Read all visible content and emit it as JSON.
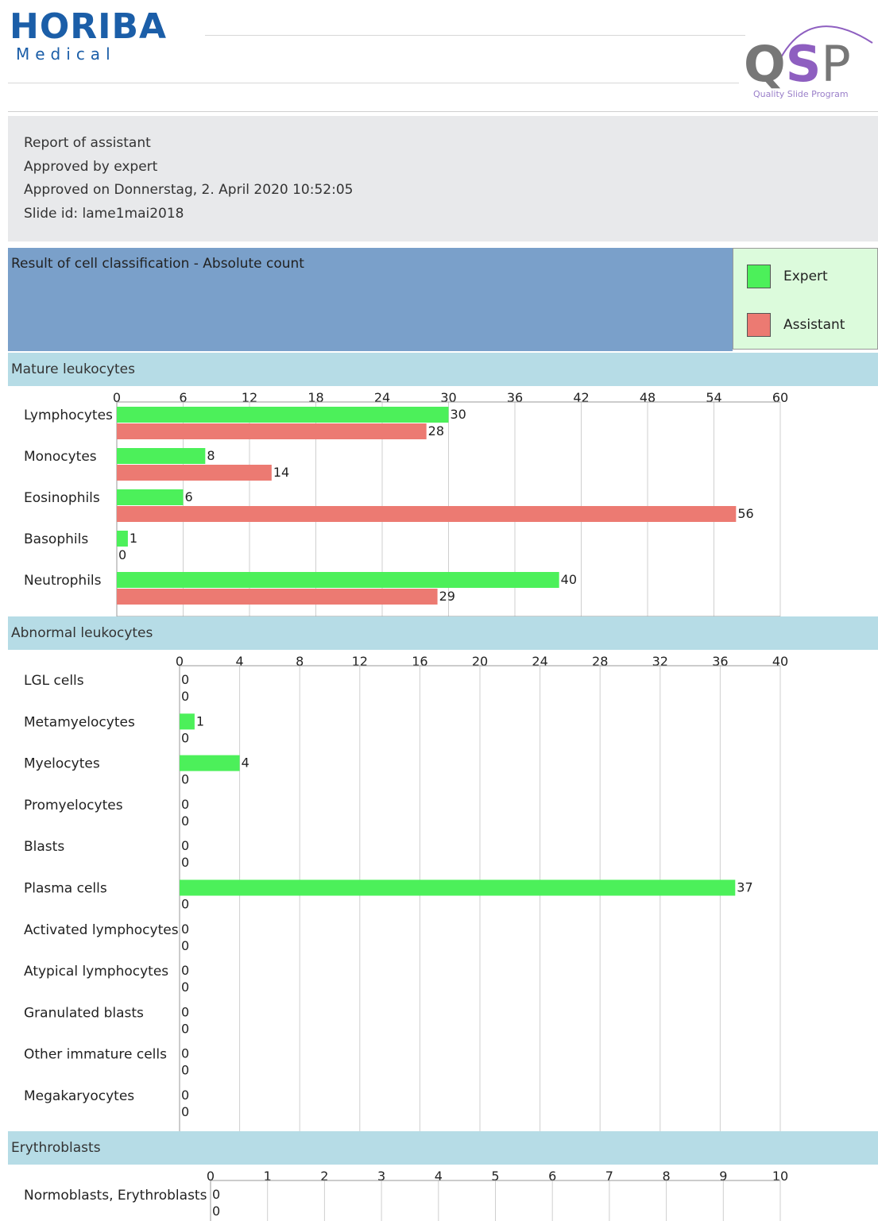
{
  "header": {
    "brand": "HORIBA",
    "brand_sub": "Medical",
    "qsp_q": "Q",
    "qsp_s": "S",
    "qsp_p": "P",
    "qsp_tagline": "Quality Slide Program"
  },
  "info": {
    "line1": "Report of assistant",
    "line2": "Approved by expert",
    "line3": "Approved on Donnerstag, 2. April 2020 10:52:05",
    "line4": "Slide id: lame1mai2018"
  },
  "result_title": "Result of cell classification - Absolute count",
  "legend": {
    "expert": "Expert",
    "assistant": "Assistant",
    "expert_color": "#4cf05a",
    "assistant_color": "#ec7a72"
  },
  "chart_data": [
    {
      "type": "bar",
      "section": "Mature leukocytes",
      "categories": [
        "Lymphocytes",
        "Monocytes",
        "Eosinophils",
        "Basophils",
        "Neutrophils"
      ],
      "series": [
        {
          "name": "Expert",
          "values": [
            30,
            8,
            6,
            1,
            40
          ]
        },
        {
          "name": "Assistant",
          "values": [
            28,
            14,
            56,
            0,
            29
          ]
        }
      ],
      "xticks": [
        0,
        6,
        12,
        18,
        24,
        30,
        36,
        42,
        48,
        54,
        60
      ],
      "xlim": [
        0,
        60
      ],
      "orientation": "horizontal"
    },
    {
      "type": "bar",
      "section": "Abnormal leukocytes",
      "categories": [
        "LGL cells",
        "Metamyelocytes",
        "Myelocytes",
        "Promyelocytes",
        "Blasts",
        "Plasma cells",
        "Activated lymphocytes",
        "Atypical lymphocytes",
        "Granulated blasts",
        "Other immature cells",
        "Megakaryocytes"
      ],
      "series": [
        {
          "name": "Expert",
          "values": [
            0,
            1,
            4,
            0,
            0,
            37,
            0,
            0,
            0,
            0,
            0
          ]
        },
        {
          "name": "Assistant",
          "values": [
            0,
            0,
            0,
            0,
            0,
            0,
            0,
            0,
            0,
            0,
            0
          ]
        }
      ],
      "xticks": [
        0,
        4,
        8,
        12,
        16,
        20,
        24,
        28,
        32,
        36,
        40
      ],
      "xlim": [
        0,
        40
      ],
      "orientation": "horizontal"
    },
    {
      "type": "bar",
      "section": "Erythroblasts",
      "categories": [
        "Normoblasts, Erythroblasts"
      ],
      "series": [
        {
          "name": "Expert",
          "values": [
            0
          ]
        },
        {
          "name": "Assistant",
          "values": [
            0
          ]
        }
      ],
      "xticks": [
        0,
        1,
        2,
        3,
        4,
        5,
        6,
        7,
        8,
        9,
        10
      ],
      "xlim": [
        0,
        10
      ],
      "orientation": "horizontal"
    }
  ]
}
